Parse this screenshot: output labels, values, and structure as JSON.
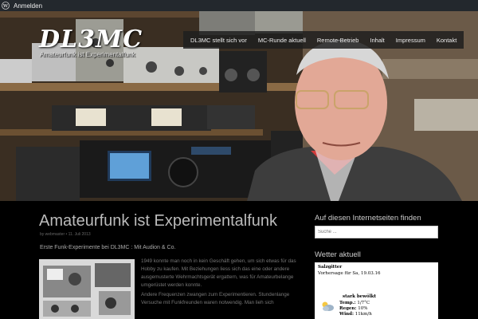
{
  "adminbar": {
    "icon": "wordpress-icon",
    "login": "Anmelden"
  },
  "site": {
    "title": "DL3MC",
    "tagline": "Amateurfunk ist Experimentalfunk"
  },
  "nav": {
    "items": [
      "DL3MC stellt sich vor",
      "MC-Runde aktuell",
      "Remote-Betrieb",
      "Inhalt",
      "Impressum",
      "Kontakt"
    ]
  },
  "post": {
    "title": "Amateurfunk ist Experimentalfunk",
    "meta": "by webmaster • 11. Juli 2013",
    "intro": "Erste Funk-Experimente bei DL3MC : Mit Audion & Co.",
    "paragraphs": [
      "1949 konnte man noch in kein Geschäft gehen, um sich etwas für das Hobby zu kaufen. Mit Beziehungen liess sich das eine oder andere ausgemusterte Wehrmachtsgerät ergattern, was für Amateurbelange umgerüstet werden konnte.",
      "Andere Frequenzen zwangen zum Experimentieren. Stundenlange Versuche mit Funkfreunden waren notwendig. Man lieh sich"
    ]
  },
  "sidebar": {
    "search_title": "Auf diesen Internetseiten finden",
    "search_placeholder": "Suche ...",
    "weather_title": "Wetter aktuell",
    "weather": {
      "place": "Salzgitter",
      "forecast": "Vorhersage für Sa, 19.03.16",
      "condition": "stark bewölkt",
      "temp_label": "Temp.:",
      "temp": "1/7°C",
      "rain_label": "Regen:",
      "rain": "10%",
      "wind_label": "Wind:",
      "wind": "11km/h",
      "icon": "cloud-sun-icon"
    }
  },
  "colors": {
    "adminbar": "#23282d",
    "nav": "#1e1e1e",
    "background": "#000000"
  }
}
